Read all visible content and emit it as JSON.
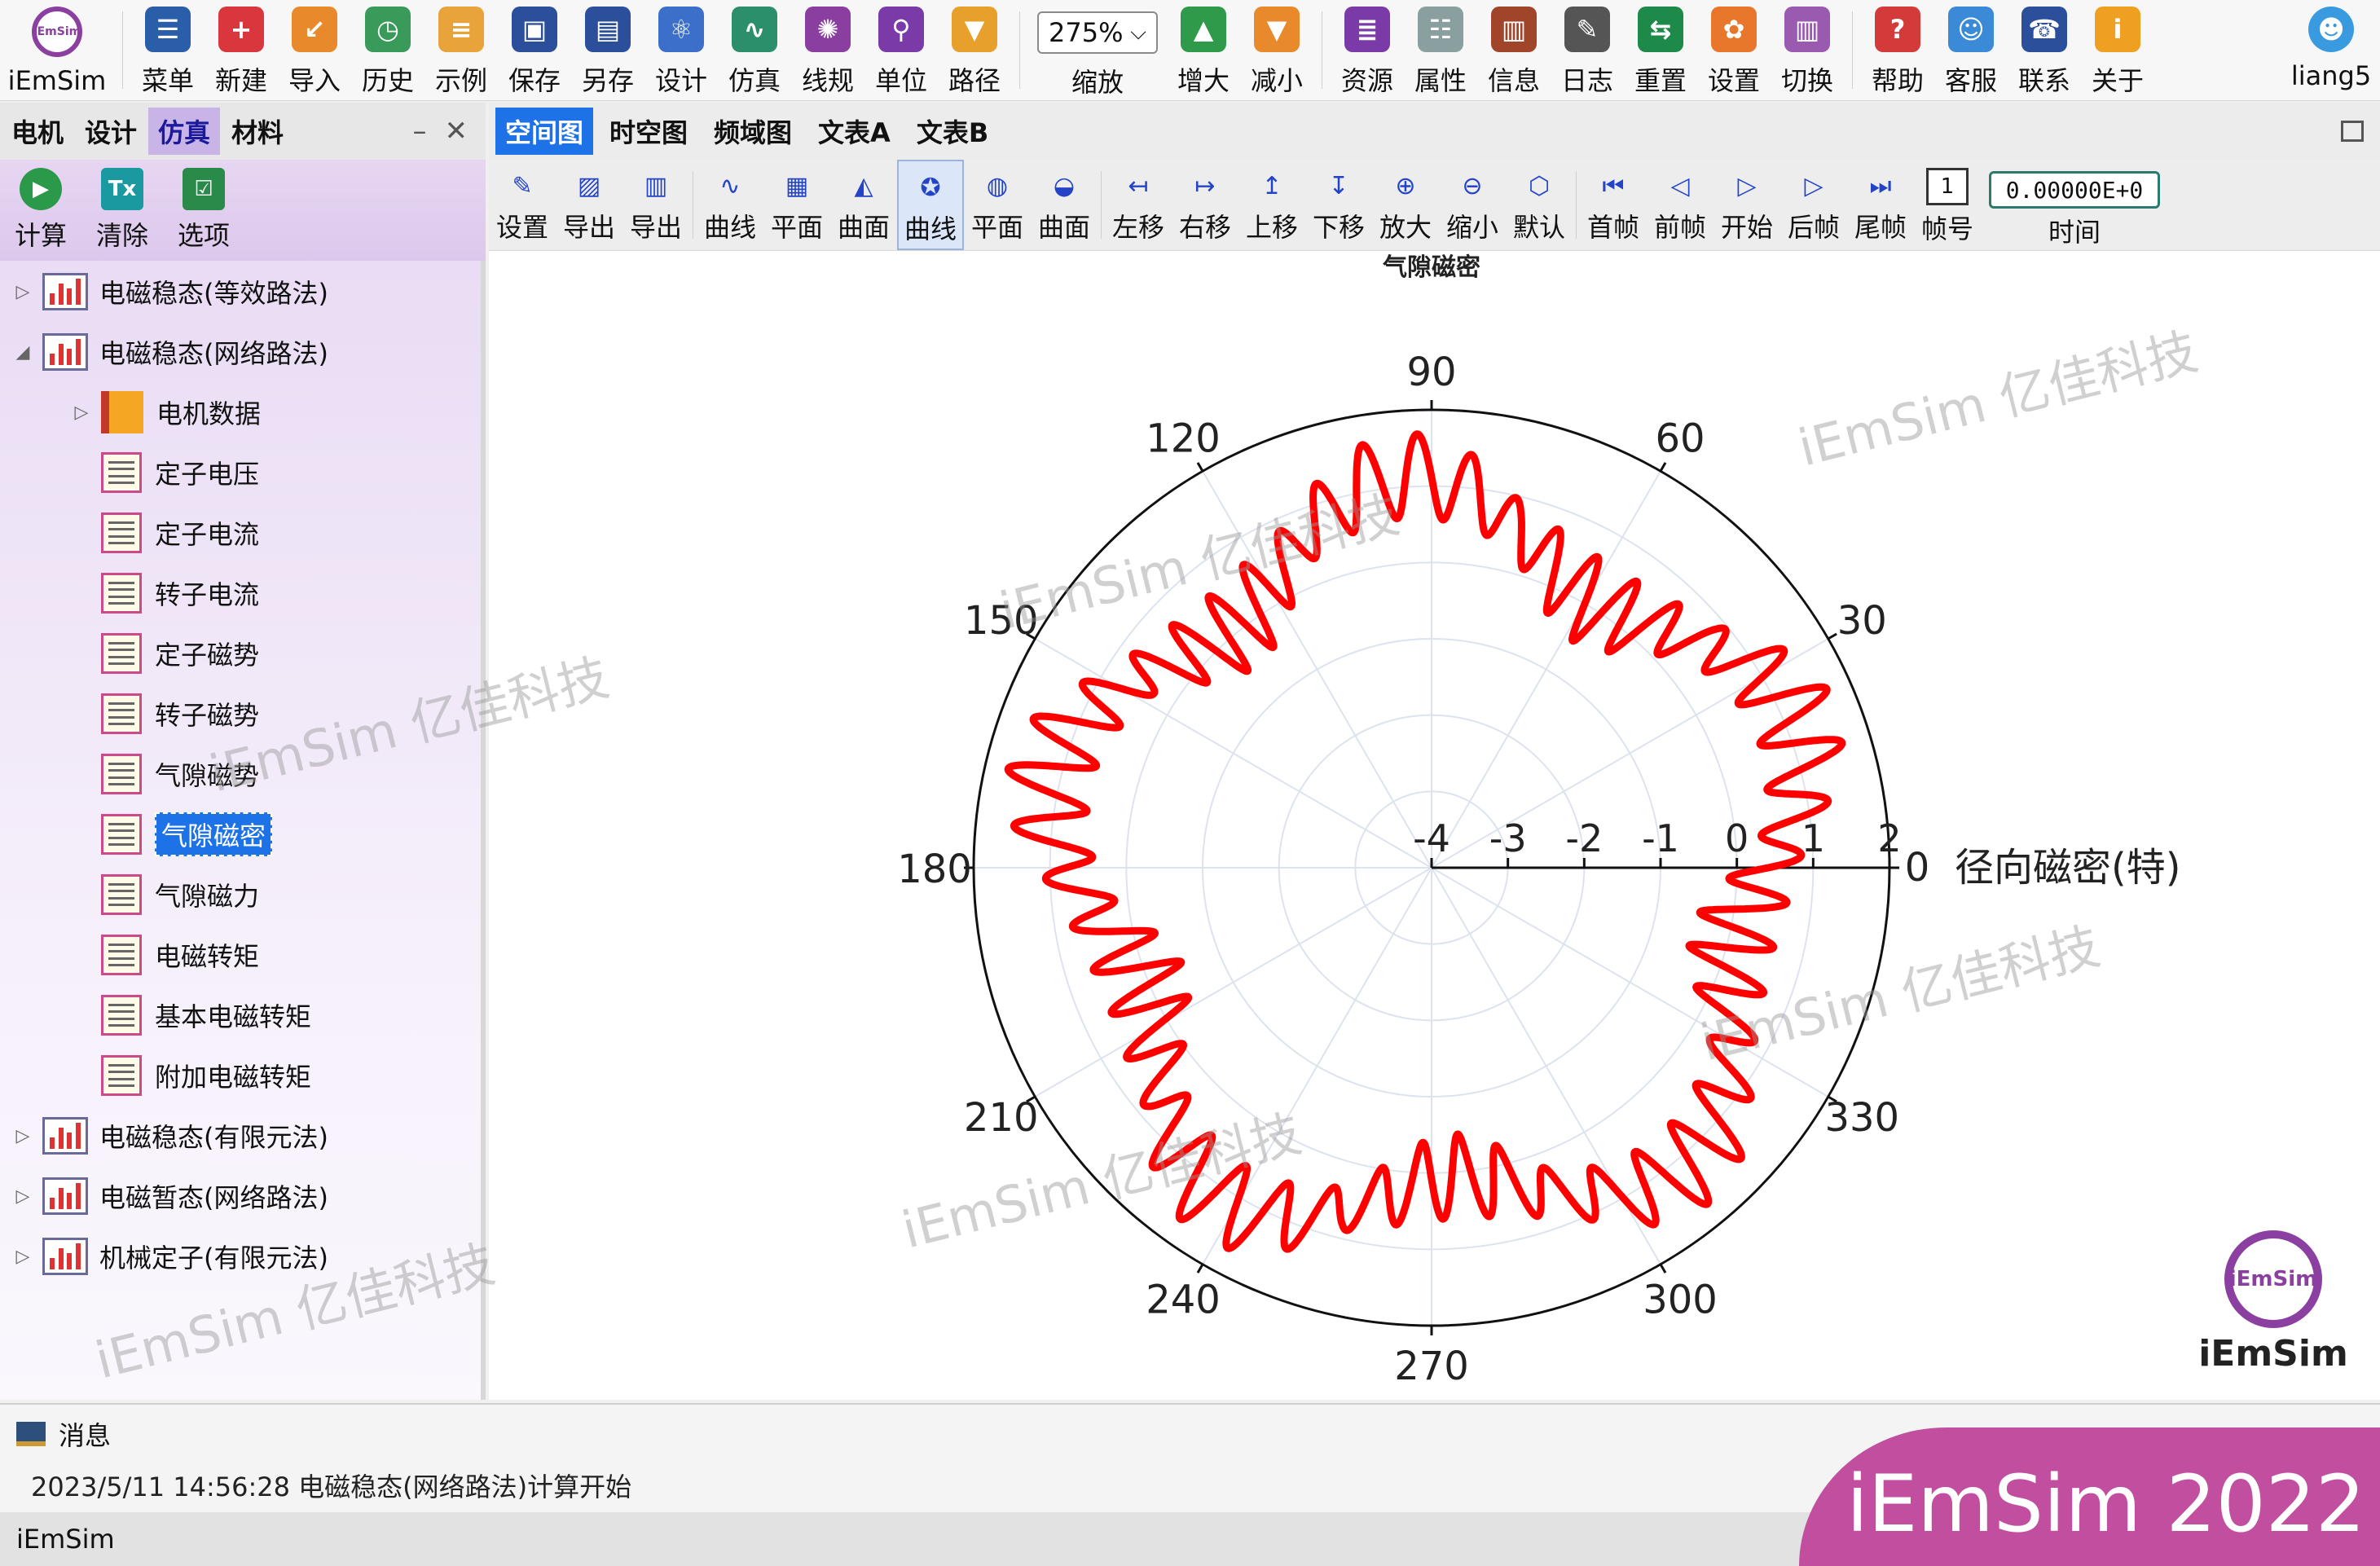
{
  "toolbar": {
    "logo_label": "iEmSim",
    "buttons": [
      {
        "label": "菜单",
        "icon": "menu-icon",
        "color": "#2b5ea8",
        "glyph": "☰"
      },
      {
        "label": "新建",
        "icon": "new-icon",
        "color": "#d9363e",
        "glyph": "+"
      },
      {
        "label": "导入",
        "icon": "import-icon",
        "color": "#e8892b",
        "glyph": "↙"
      },
      {
        "label": "历史",
        "icon": "history-icon",
        "color": "#3a9a5a",
        "glyph": "◷"
      },
      {
        "label": "示例",
        "icon": "example-icon",
        "color": "#e8a33b",
        "glyph": "≡"
      },
      {
        "label": "保存",
        "icon": "save-icon",
        "color": "#2b4f9a",
        "glyph": "▣"
      },
      {
        "label": "另存",
        "icon": "save-as-icon",
        "color": "#2b4f9a",
        "glyph": "▤"
      },
      {
        "label": "设计",
        "icon": "design-icon",
        "color": "#3b6fc9",
        "glyph": "⚛"
      },
      {
        "label": "仿真",
        "icon": "simulate-icon",
        "color": "#2a8f6a",
        "glyph": "∿"
      },
      {
        "label": "线规",
        "icon": "wire-gauge-icon",
        "color": "#8a3fa0",
        "glyph": "✺"
      },
      {
        "label": "单位",
        "icon": "unit-icon",
        "color": "#7a3aa8",
        "glyph": "⚲"
      },
      {
        "label": "路径",
        "icon": "path-icon",
        "color": "#e7a02b",
        "glyph": "▼"
      }
    ],
    "zoom": {
      "value": "275%",
      "label": "缩放"
    },
    "zoom_buttons": [
      {
        "label": "增大",
        "icon": "zoom-in-arrow-icon",
        "color": "#2f9a4a",
        "glyph": "▲"
      },
      {
        "label": "减小",
        "icon": "zoom-out-arrow-icon",
        "color": "#e8892b",
        "glyph": "▼"
      }
    ],
    "buttons_right": [
      {
        "label": "资源",
        "icon": "resource-icon",
        "color": "#7a3aa8",
        "glyph": "≣"
      },
      {
        "label": "属性",
        "icon": "property-icon",
        "color": "#8aa0a0",
        "glyph": "☷"
      },
      {
        "label": "信息",
        "icon": "info-book-icon",
        "color": "#a0442a",
        "glyph": "▥"
      },
      {
        "label": "日志",
        "icon": "log-icon",
        "color": "#555555",
        "glyph": "✎"
      },
      {
        "label": "重置",
        "icon": "reset-icon",
        "color": "#1e8a4a",
        "glyph": "⇆"
      },
      {
        "label": "设置",
        "icon": "settings-icon",
        "color": "#e8762b",
        "glyph": "✿"
      },
      {
        "label": "切换",
        "icon": "switch-icon",
        "color": "#9a5ab0",
        "glyph": "▥"
      }
    ],
    "buttons_help": [
      {
        "label": "帮助",
        "icon": "help-icon",
        "color": "#d33b3b",
        "glyph": "?"
      },
      {
        "label": "客服",
        "icon": "customer-service-icon",
        "color": "#3a8ad8",
        "glyph": "☺"
      },
      {
        "label": "联系",
        "icon": "contact-phone-icon",
        "color": "#2b4f9a",
        "glyph": "☎"
      },
      {
        "label": "关于",
        "icon": "about-icon",
        "color": "#f0a020",
        "glyph": "i"
      }
    ],
    "user": {
      "label": "liang5",
      "icon": "user-avatar-icon",
      "color": "#3a9ae0"
    }
  },
  "left_panel": {
    "tabs": [
      "电机",
      "设计",
      "仿真",
      "材料"
    ],
    "active_tab": 2,
    "minimize": "–",
    "close": "✕",
    "tools": [
      {
        "label": "计算",
        "icon": "run-icon",
        "color": "#2a9a4a"
      },
      {
        "label": "清除",
        "icon": "clear-format-icon",
        "color": "#1a9aa0"
      },
      {
        "label": "选项",
        "icon": "options-checklist-icon",
        "color": "#2a8a4a"
      }
    ],
    "tree": [
      {
        "label": "电磁稳态(等效路法)",
        "level": 0,
        "expander": "▷",
        "kind": "folder"
      },
      {
        "label": "电磁稳态(网络路法)",
        "level": 0,
        "expander": "◢",
        "kind": "folder"
      },
      {
        "label": "电机数据",
        "level": 1,
        "expander": "▷",
        "kind": "data"
      },
      {
        "label": "定子电压",
        "level": 1,
        "expander": "",
        "kind": "doc"
      },
      {
        "label": "定子电流",
        "level": 1,
        "expander": "",
        "kind": "doc"
      },
      {
        "label": "转子电流",
        "level": 1,
        "expander": "",
        "kind": "doc"
      },
      {
        "label": "定子磁势",
        "level": 1,
        "expander": "",
        "kind": "doc"
      },
      {
        "label": "转子磁势",
        "level": 1,
        "expander": "",
        "kind": "doc"
      },
      {
        "label": "气隙磁势",
        "level": 1,
        "expander": "",
        "kind": "doc"
      },
      {
        "label": "气隙磁密",
        "level": 1,
        "expander": "",
        "kind": "doc",
        "selected": true
      },
      {
        "label": "气隙磁力",
        "level": 1,
        "expander": "",
        "kind": "doc"
      },
      {
        "label": "电磁转矩",
        "level": 1,
        "expander": "",
        "kind": "doc"
      },
      {
        "label": "基本电磁转矩",
        "level": 1,
        "expander": "",
        "kind": "doc"
      },
      {
        "label": "附加电磁转矩",
        "level": 1,
        "expander": "",
        "kind": "doc"
      },
      {
        "label": "电磁稳态(有限元法)",
        "level": 0,
        "expander": "▷",
        "kind": "folder"
      },
      {
        "label": "电磁暂态(网络路法)",
        "level": 0,
        "expander": "▷",
        "kind": "folder"
      },
      {
        "label": "机械定子(有限元法)",
        "level": 0,
        "expander": "▷",
        "kind": "folder"
      }
    ]
  },
  "right_panel": {
    "tabs": [
      "空间图",
      "时空图",
      "频域图",
      "文表A",
      "文表B"
    ],
    "active_tab": 0,
    "tools": [
      {
        "label": "设置",
        "icon": "chart-settings-icon",
        "glyph": "✎"
      },
      {
        "label": "导出",
        "icon": "export-image-icon",
        "glyph": "▨"
      },
      {
        "label": "导出",
        "icon": "export-data-icon",
        "glyph": "▥"
      },
      {
        "sep": true
      },
      {
        "label": "曲线",
        "icon": "curve-icon",
        "glyph": "∿"
      },
      {
        "label": "平面",
        "icon": "plane-icon",
        "glyph": "▦"
      },
      {
        "label": "曲面",
        "icon": "surface-icon",
        "glyph": "◭"
      },
      {
        "label": "曲线",
        "icon": "polar-curve-icon",
        "glyph": "✪",
        "active": true
      },
      {
        "label": "平面",
        "icon": "polar-plane-icon",
        "glyph": "◍"
      },
      {
        "label": "曲面",
        "icon": "polar-surface-icon",
        "glyph": "◒"
      },
      {
        "sep": true
      },
      {
        "label": "左移",
        "icon": "move-left-icon",
        "glyph": "↤"
      },
      {
        "label": "右移",
        "icon": "move-right-icon",
        "glyph": "↦"
      },
      {
        "label": "上移",
        "icon": "move-up-icon",
        "glyph": "↥"
      },
      {
        "label": "下移",
        "icon": "move-down-icon",
        "glyph": "↧"
      },
      {
        "label": "放大",
        "icon": "zoom-in-icon",
        "glyph": "⊕"
      },
      {
        "label": "缩小",
        "icon": "zoom-out-icon",
        "glyph": "⊖"
      },
      {
        "label": "默认",
        "icon": "default-view-icon",
        "glyph": "⬡"
      },
      {
        "sep": true
      },
      {
        "label": "首帧",
        "icon": "first-frame-icon",
        "glyph": "⏮"
      },
      {
        "label": "前帧",
        "icon": "prev-frame-icon",
        "glyph": "◁"
      },
      {
        "label": "开始",
        "icon": "play-icon",
        "glyph": "▷"
      },
      {
        "label": "后帧",
        "icon": "next-frame-icon",
        "glyph": "▷"
      },
      {
        "label": "尾帧",
        "icon": "last-frame-icon",
        "glyph": "⏭"
      }
    ],
    "frame": {
      "label": "帧号",
      "value": "1"
    },
    "time": {
      "label": "时间",
      "value": "0.00000E+0"
    }
  },
  "chart_data": {
    "type": "polar-line",
    "title": "气隙磁密",
    "radial_label": "径向磁密(特)",
    "radial_ticks": [
      "-4",
      "-3",
      "-2",
      "-1",
      "0",
      "1",
      "2"
    ],
    "rlim": [
      -4,
      2
    ],
    "angle_ticks": [
      "0",
      "30",
      "60",
      "90",
      "120",
      "150",
      "180",
      "210",
      "240",
      "270",
      "300",
      "330"
    ],
    "grid": true,
    "series": [
      {
        "color": "#ff0000",
        "description_components": {
          "mean": 0.6,
          "pole_pairs": 5,
          "fundamental_amplitude": 0.55,
          "slot_harmonic_order": 48,
          "slot_harmonic_amplitude": 0.55
        },
        "min_value": -0.6,
        "max_value": 1.4
      }
    ]
  },
  "message_panel": {
    "title": "消息",
    "lines": [
      "2023/5/11 14:56:28  电磁稳态(网络路法)计算开始"
    ]
  },
  "status_bar": {
    "text": "iEmSim"
  },
  "brand": {
    "banner": "iEmSim 2022",
    "logo_text": "iEmSim",
    "logo_inner": "iEmSim"
  },
  "watermark": "iEmSim 亿佳科技"
}
